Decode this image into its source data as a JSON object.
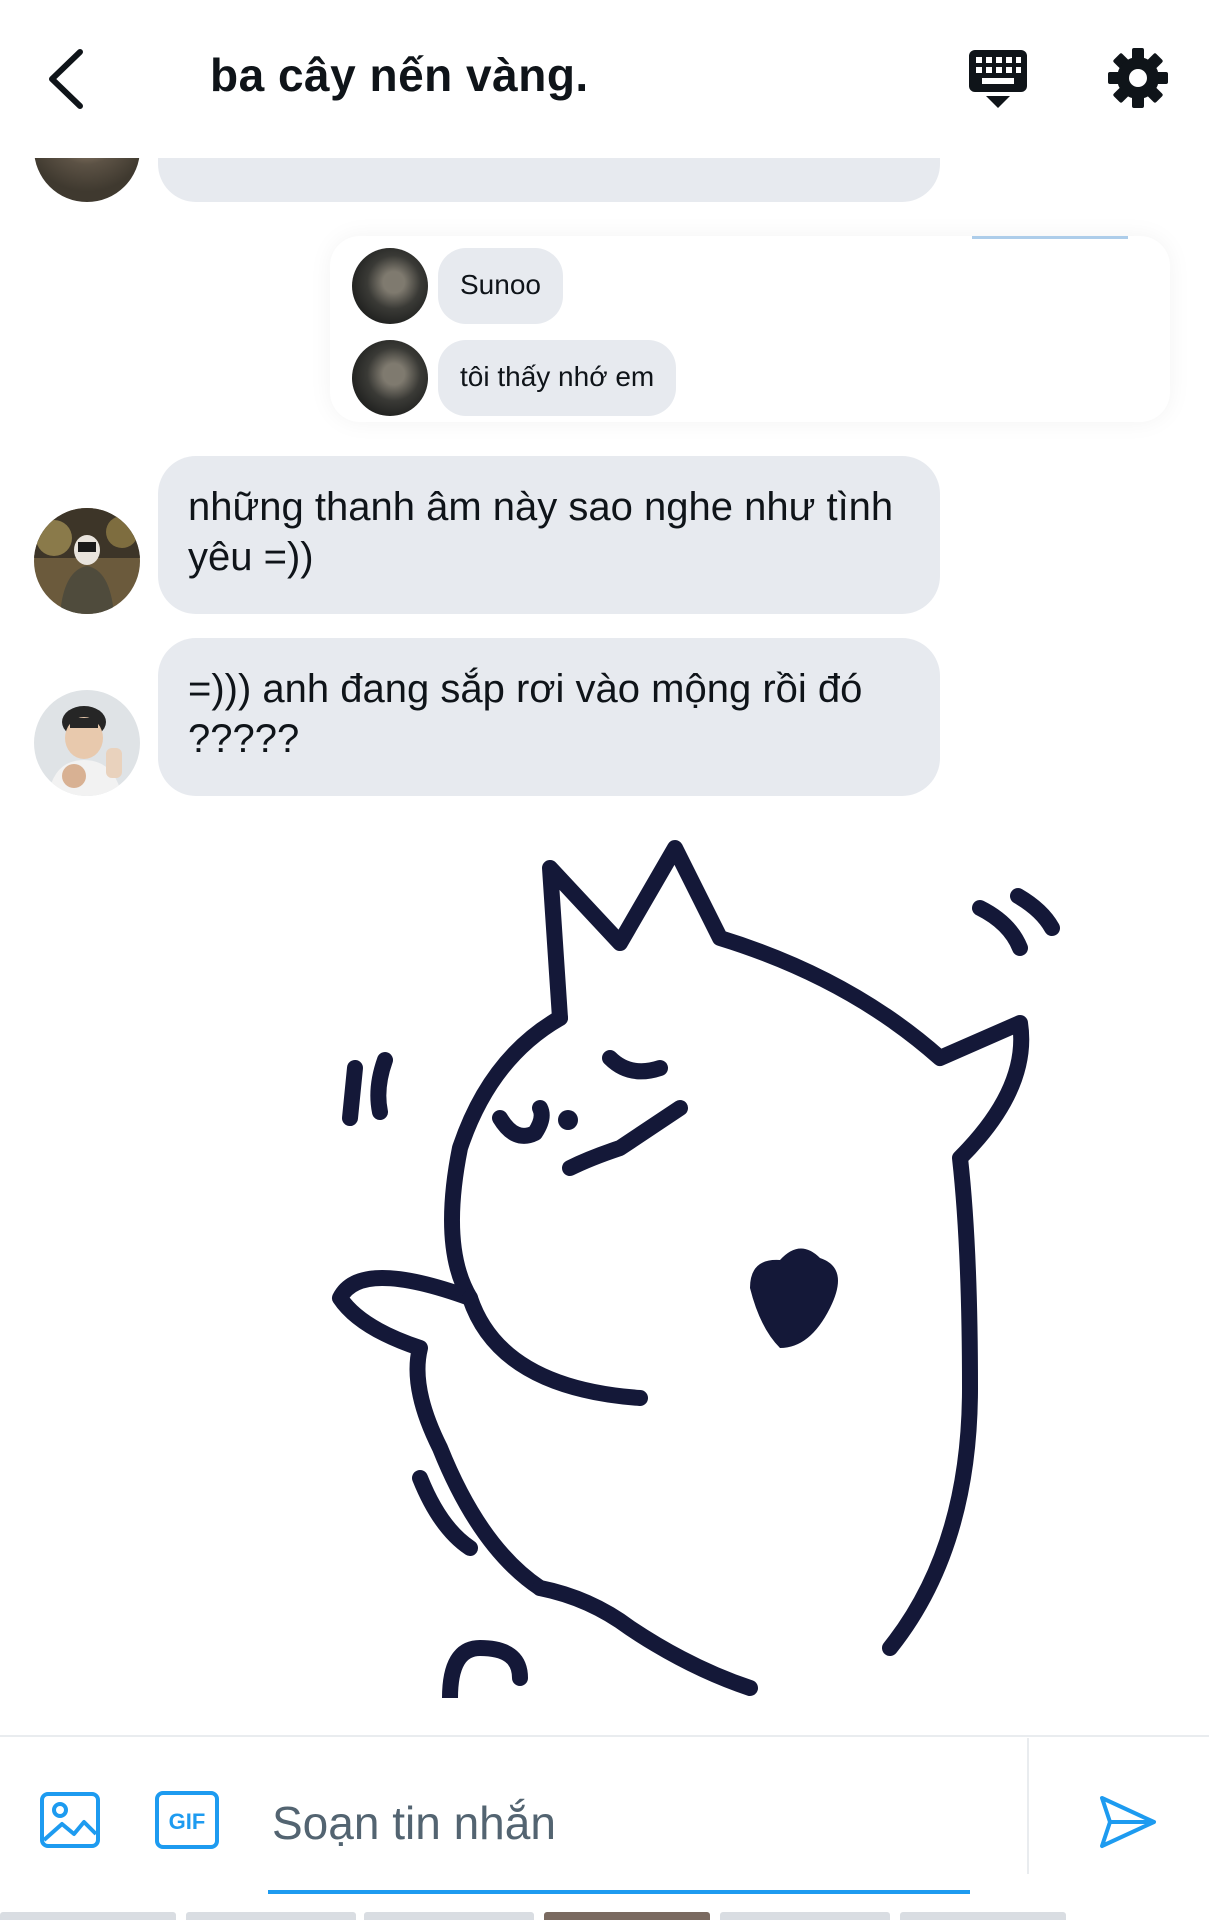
{
  "header": {
    "title": "ba cây nến vàng."
  },
  "messages": [
    {
      "text": "những thanh âm này sao nghe như tình yêu =))"
    },
    {
      "text": "=))) anh đang sắp rơi vào mộng rồi đó ?????"
    }
  ],
  "quoted": {
    "name": "Sunoo",
    "text": "tôi thấy nhớ em"
  },
  "composer": {
    "placeholder": "Soạn tin nhắn",
    "gif_label": "GIF"
  },
  "colors": {
    "accent": "#1d9bf0",
    "bubble": "#e7eaef"
  },
  "icons": [
    "back-arrow-icon",
    "keyboard-icon",
    "gear-icon",
    "image-icon",
    "gif-icon",
    "send-icon"
  ]
}
